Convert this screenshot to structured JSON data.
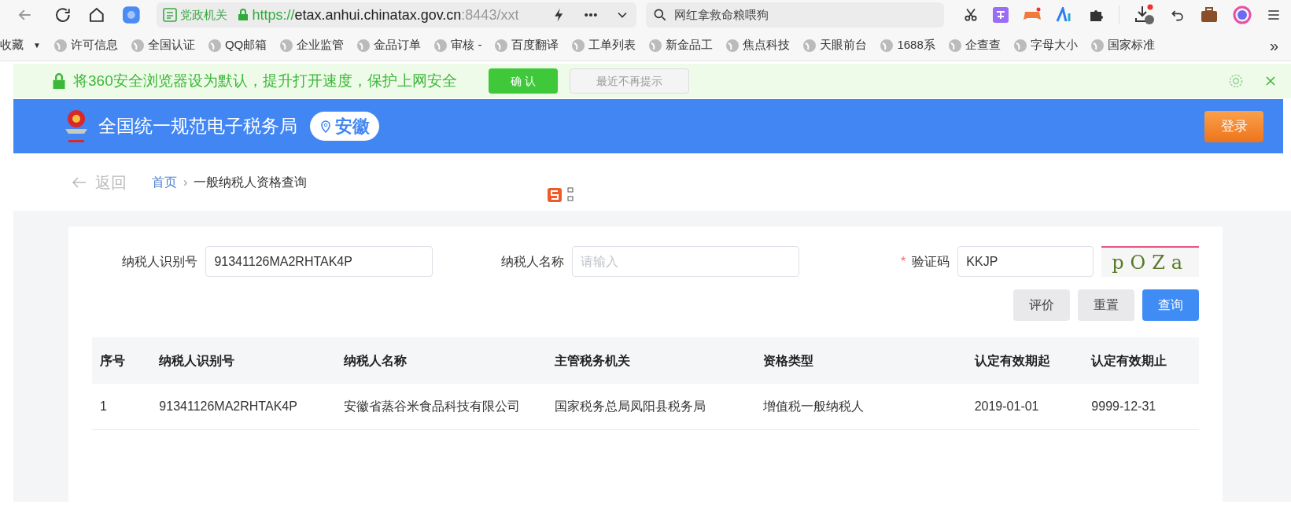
{
  "browser": {
    "url_badge": "党政机关",
    "url_scheme": "https://",
    "url_host": "etax.anhui.chinatax.gov.cn",
    "url_rest": ":8443/xxt",
    "search_text": "网红拿救命粮喂狗"
  },
  "bookmarks": [
    {
      "label": "收藏"
    },
    {
      "label": "许可信息"
    },
    {
      "label": "全国认证"
    },
    {
      "label": "QQ邮箱"
    },
    {
      "label": "企业监管"
    },
    {
      "label": "金品订单"
    },
    {
      "label": "审核 -"
    },
    {
      "label": "百度翻译"
    },
    {
      "label": "工单列表"
    },
    {
      "label": "新金品工"
    },
    {
      "label": "焦点科技"
    },
    {
      "label": "天眼前台"
    },
    {
      "label": "1688系"
    },
    {
      "label": "企查查"
    },
    {
      "label": "字母大小"
    },
    {
      "label": "国家标准"
    }
  ],
  "bookmarks_more": "»",
  "bookmarks_caret": "▼",
  "required_mark": "*",
  "notice": {
    "text": "将360安全浏览器设为默认，提升打开速度，保护上网安全",
    "confirm": "确 认",
    "dismiss": "最近不再提示"
  },
  "header": {
    "title": "全国统一规范电子税务局",
    "location": "安徽",
    "login": "登录"
  },
  "breadcrumb": {
    "back": "返回",
    "items": [
      "首页",
      "一般纳税人资格查询"
    ],
    "separator": "›"
  },
  "form": {
    "fields": [
      {
        "label": "纳税人识别号",
        "value": "91341126MA2RHTAK4P",
        "required": false
      },
      {
        "label": "纳税人名称",
        "placeholder": "请输入",
        "required": false
      },
      {
        "label": "验证码",
        "value": "KKJP",
        "required": true
      }
    ],
    "captcha": "pOZa",
    "buttons": [
      {
        "label": "评价",
        "primary": false
      },
      {
        "label": "重置",
        "primary": false
      },
      {
        "label": "查询",
        "primary": true
      }
    ]
  },
  "table": {
    "columns": [
      "序号",
      "纳税人识别号",
      "纳税人名称",
      "主管税务机关",
      "资格类型",
      "认定有效期起",
      "认定有效期止"
    ],
    "rows": [
      [
        "1",
        "91341126MA2RHTAK4P",
        "安徽省蒸谷米食品科技有限公司",
        "国家税务总局凤阳县税务局",
        "增值税一般纳税人",
        "2019-01-01",
        "9999-12-31"
      ]
    ]
  }
}
